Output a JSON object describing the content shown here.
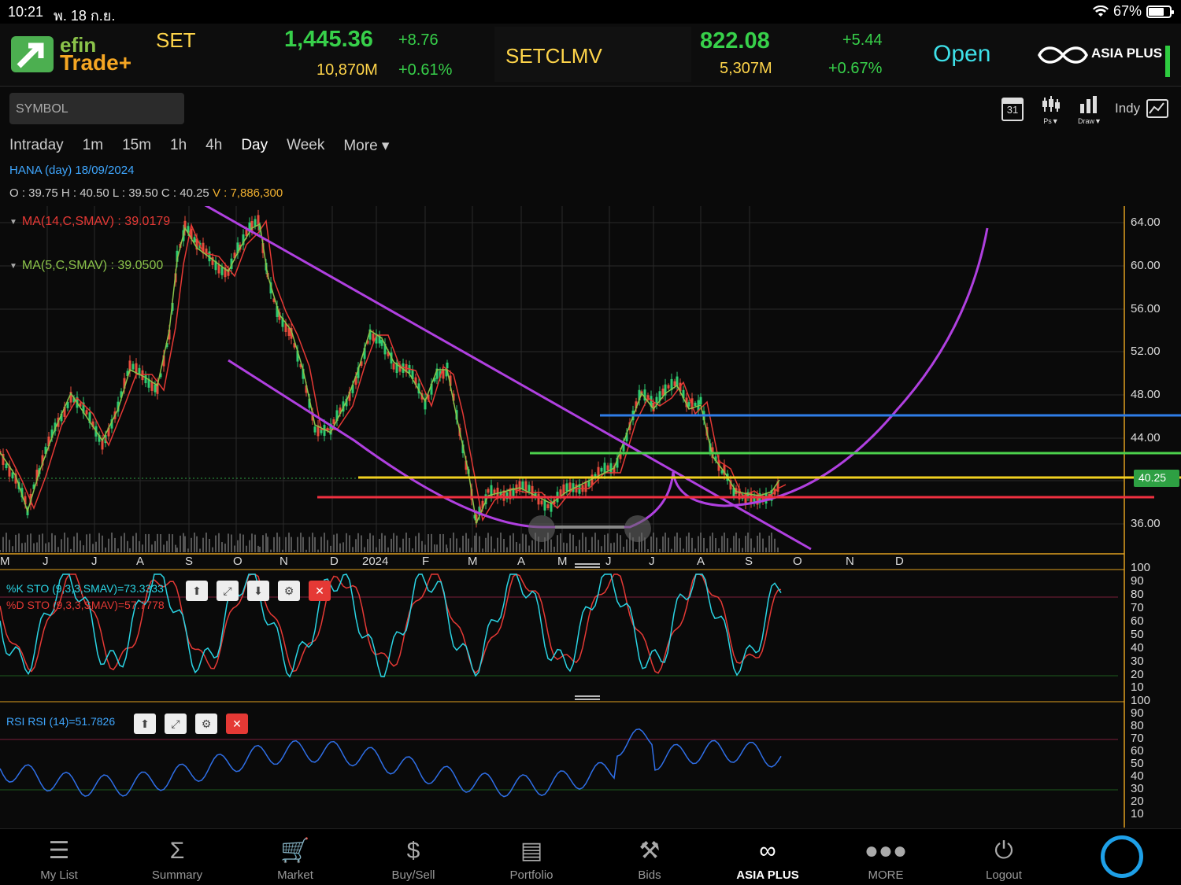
{
  "status_bar": {
    "time": "10:21",
    "date": "พ. 18 ก.ย.",
    "battery": "67%"
  },
  "header": {
    "logo_top": "efin",
    "logo_bottom": "Trade+",
    "index1": {
      "name": "SET",
      "value": "1,445.36",
      "change": "+8.76",
      "volume": "10,870M",
      "pct": "+0.61%"
    },
    "index2": {
      "name": "SETCLMV",
      "value": "822.08",
      "change": "+5.44",
      "volume": "5,307M",
      "pct": "+0.67%"
    },
    "market_status": "Open",
    "broker": "ASIA PLUS"
  },
  "toolbar": {
    "symbol_placeholder": "SYMBOL",
    "calendar_day": "31",
    "ps_label": "Ps▼",
    "draw_label": "Draw▼",
    "indy_label": "Indy"
  },
  "timeframes": [
    "Intraday",
    "1m",
    "15m",
    "1h",
    "4h",
    "Day",
    "Week",
    "More ▾"
  ],
  "active_timeframe": "Day",
  "chart": {
    "title": "HANA (day) 18/09/2024",
    "ohlc": "O : 39.75 H : 40.50 L : 39.50 C : 40.25",
    "volume": "V : 7,886,300",
    "ma14": "MA(14,C,SMAV) : 39.0179",
    "ma5": "MA(5,C,SMAV) : 39.0500",
    "last_price_tag": "40.25",
    "price_ticks": [
      "64.00",
      "60.00",
      "56.00",
      "52.00",
      "48.00",
      "44.00",
      "36.00"
    ],
    "months": [
      "M",
      "J",
      "J",
      "A",
      "S",
      "O",
      "N",
      "D",
      "2024",
      "F",
      "M",
      "A",
      "M",
      "J",
      "J",
      "A",
      "S",
      "O",
      "N",
      "D"
    ],
    "sto_k": "%K STO (9,3,3,SMAV)=73.3333",
    "sto_d": "%D STO (9,3,3,SMAV)=57.7778",
    "sto_ticks": [
      "100",
      "90",
      "80",
      "70",
      "60",
      "50",
      "40",
      "30",
      "20",
      "10",
      "100"
    ],
    "rsi": "RSI RSI (14)=51.7826",
    "rsi_ticks": [
      "90",
      "80",
      "70",
      "60",
      "50",
      "40",
      "30",
      "20",
      "10"
    ]
  },
  "bottom_nav": [
    {
      "label": "My List",
      "icon": "list-icon"
    },
    {
      "label": "Summary",
      "icon": "sigma-icon"
    },
    {
      "label": "Market",
      "icon": "cart-icon"
    },
    {
      "label": "Buy/Sell",
      "icon": "buy-sell-icon"
    },
    {
      "label": "Portfolio",
      "icon": "portfolio-icon"
    },
    {
      "label": "Bids",
      "icon": "gavel-icon"
    },
    {
      "label": "ASIA PLUS",
      "icon": "asia-plus-icon"
    },
    {
      "label": "MORE",
      "icon": "more-icon"
    },
    {
      "label": "Logout",
      "icon": "power-icon"
    }
  ],
  "colors": {
    "accent_green": "#37d04a",
    "accent_yellow": "#ffd54a",
    "open_cyan": "#3ee0e8",
    "drawing_purple": "#b040e0"
  }
}
